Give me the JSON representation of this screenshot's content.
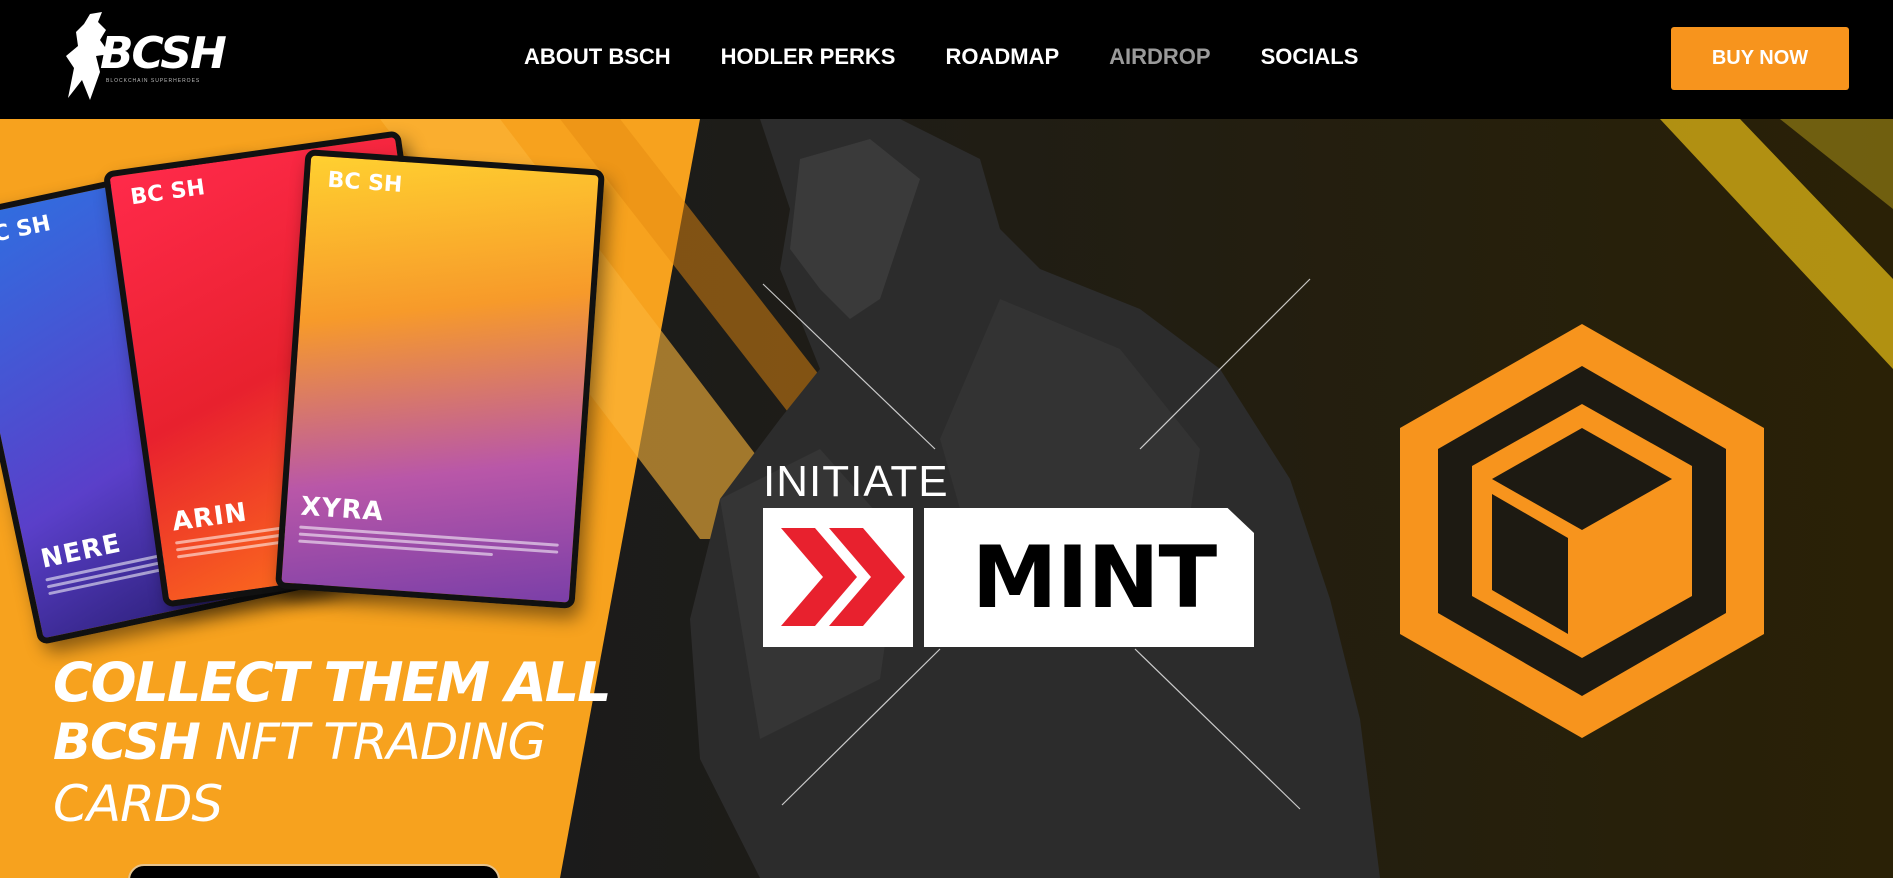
{
  "nav": {
    "logo_text": "BCSH",
    "logo_sub": "BLOCKCHAIN SUPERHEROES",
    "links": [
      "ABOUT BSCH",
      "HODLER PERKS",
      "ROADMAP",
      "AIRDROP",
      "SOCIALS"
    ],
    "buy_label": "BUY NOW"
  },
  "cards": [
    {
      "name": "NERE",
      "logo": "BC SH"
    },
    {
      "name": "ARIN",
      "logo": "BC SH"
    },
    {
      "name": "XYRA",
      "logo": "BC SH"
    }
  ],
  "hero": {
    "title": "COLLECT THEM ALL",
    "sub_bold": "BCSH",
    "sub_rest": " NFT TRADING CARDS",
    "initiate": "INITIATE",
    "mint_label": "MINT"
  },
  "colors": {
    "accent": "#f7941d",
    "hero_orange": "#f7a21e",
    "mint_red": "#e8212e",
    "dark": "#1a1a1a"
  },
  "icons": [
    "chevrons-right-icon",
    "hexagon-cube-icon"
  ]
}
